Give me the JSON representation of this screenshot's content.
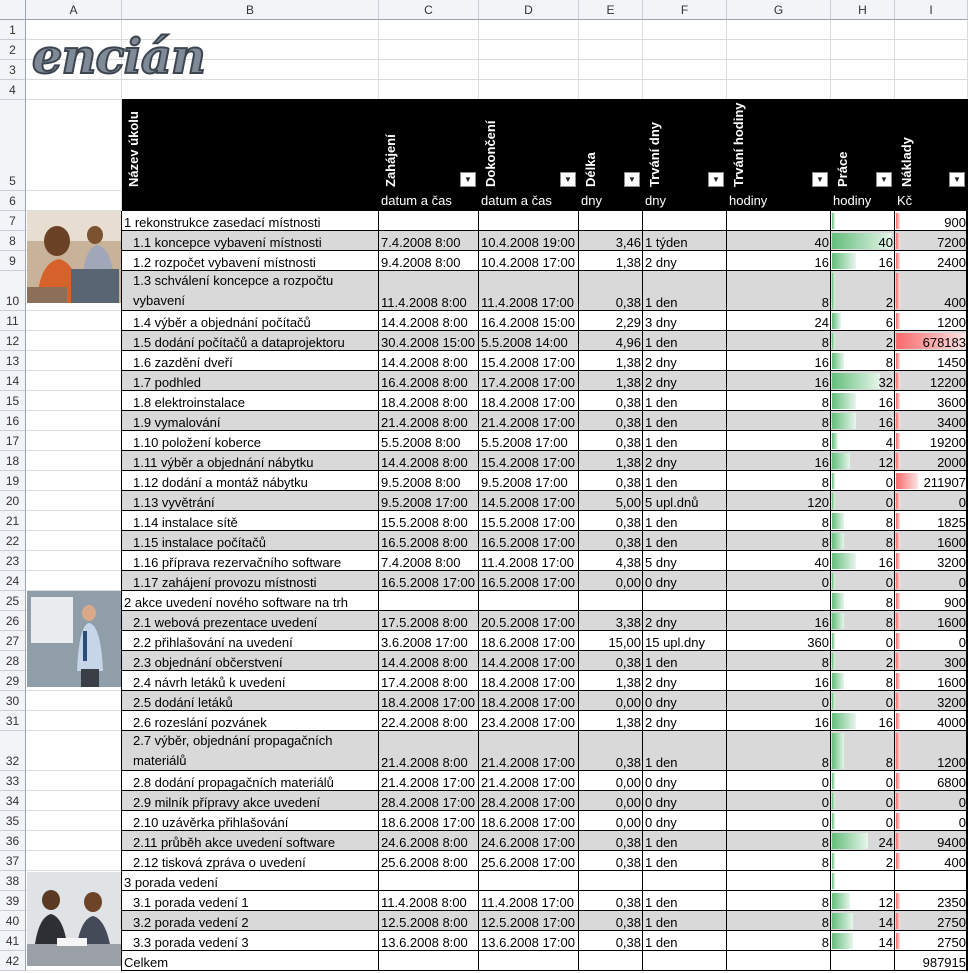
{
  "logo": {
    "text": "encián"
  },
  "columns": [
    "A",
    "B",
    "C",
    "D",
    "E",
    "F",
    "G",
    "H",
    "I"
  ],
  "rows": [
    "1",
    "2",
    "3",
    "4",
    "5",
    "6",
    "7",
    "8",
    "9",
    "10",
    "11",
    "12",
    "13",
    "14",
    "15",
    "16",
    "17",
    "18",
    "19",
    "20",
    "21",
    "22",
    "23",
    "24",
    "25",
    "26",
    "27",
    "28",
    "29",
    "30",
    "31",
    "32",
    "33",
    "34",
    "35",
    "36",
    "37",
    "38",
    "39",
    "40",
    "41",
    "42"
  ],
  "headers": [
    "Název úkolu",
    "Zahájení",
    "Dokončení",
    "Délka",
    "Trvání dny",
    "Trvání hodiny",
    "Práce",
    "Náklady"
  ],
  "units": [
    "datum a čas",
    "datum a čas",
    "dny",
    "dny",
    "hodiny",
    "hodiny",
    "Kč"
  ],
  "dropdown_icon": "filter-dropdown-icon",
  "colors": {
    "header_bg": "#000000",
    "row_alt": "#d9d9d9",
    "work_bar": "#63be7b",
    "cost_bar": "#f8696b"
  },
  "tasks": [
    {
      "r": 7,
      "name": "1 rekonstrukce zasedací místnosti",
      "summary": true,
      "start": "",
      "end": "",
      "len": "",
      "dur": "",
      "hrs": "",
      "work": "",
      "cost": "900",
      "w": 0,
      "c": 0.001
    },
    {
      "r": 8,
      "name": "1.1 koncepce vybavení místnosti",
      "start": "7.4.2008 8:00",
      "end": "10.4.2008 19:00",
      "len": "3,46",
      "dur": "1 týden",
      "hrs": "40",
      "work": "40",
      "cost": "7200",
      "w": 40,
      "c": 7200
    },
    {
      "r": 9,
      "name": "1.2 rozpočet vybavení místnosti",
      "start": "9.4.2008 8:00",
      "end": "10.4.2008 17:00",
      "len": "1,38",
      "dur": "2 dny",
      "hrs": "16",
      "work": "16",
      "cost": "2400",
      "w": 16,
      "c": 2400
    },
    {
      "r": 10,
      "name": "1.3 schválení koncepce a rozpočtu vybavení",
      "start": "11.4.2008 8:00",
      "end": "11.4.2008 17:00",
      "len": "0,38",
      "dur": "1 den",
      "hrs": "8",
      "work": "2",
      "cost": "400",
      "w": 2,
      "c": 400
    },
    {
      "r": 11,
      "name": "1.4 výběr a objednání počítačů",
      "start": "14.4.2008 8:00",
      "end": "16.4.2008 15:00",
      "len": "2,29",
      "dur": "3 dny",
      "hrs": "24",
      "work": "6",
      "cost": "1200",
      "w": 6,
      "c": 1200
    },
    {
      "r": 12,
      "name": "1.5 dodání počítačů a dataprojektoru",
      "start": "30.4.2008 15:00",
      "end": "5.5.2008 14:00",
      "len": "4,96",
      "dur": "1 den",
      "hrs": "8",
      "work": "2",
      "cost": "678183",
      "w": 2,
      "c": 678183
    },
    {
      "r": 13,
      "name": "1.6 zazdění dveří",
      "start": "14.4.2008 8:00",
      "end": "15.4.2008 17:00",
      "len": "1,38",
      "dur": "2 dny",
      "hrs": "16",
      "work": "8",
      "cost": "1450",
      "w": 8,
      "c": 1450
    },
    {
      "r": 14,
      "name": "1.7 podhled",
      "start": "16.4.2008 8:00",
      "end": "17.4.2008 17:00",
      "len": "1,38",
      "dur": "2 dny",
      "hrs": "16",
      "work": "32",
      "cost": "12200",
      "w": 32,
      "c": 12200
    },
    {
      "r": 15,
      "name": "1.8 elektroinstalace",
      "start": "18.4.2008 8:00",
      "end": "18.4.2008 17:00",
      "len": "0,38",
      "dur": "1 den",
      "hrs": "8",
      "work": "16",
      "cost": "3600",
      "w": 16,
      "c": 3600
    },
    {
      "r": 16,
      "name": "1.9 vymalování",
      "start": "21.4.2008 8:00",
      "end": "21.4.2008 17:00",
      "len": "0,38",
      "dur": "1 den",
      "hrs": "8",
      "work": "16",
      "cost": "3400",
      "w": 16,
      "c": 3400
    },
    {
      "r": 17,
      "name": "1.10 položení koberce",
      "start": "5.5.2008 8:00",
      "end": "5.5.2008 17:00",
      "len": "0,38",
      "dur": "1 den",
      "hrs": "8",
      "work": "4",
      "cost": "19200",
      "w": 4,
      "c": 19200
    },
    {
      "r": 18,
      "name": "1.11 výběr a objednání nábytku",
      "start": "14.4.2008 8:00",
      "end": "15.4.2008 17:00",
      "len": "1,38",
      "dur": "2 dny",
      "hrs": "16",
      "work": "12",
      "cost": "2000",
      "w": 12,
      "c": 2000
    },
    {
      "r": 19,
      "name": "1.12 dodání a montáž nábytku",
      "start": "9.5.2008 8:00",
      "end": "9.5.2008 17:00",
      "len": "0,38",
      "dur": "1 den",
      "hrs": "8",
      "work": "0",
      "cost": "211907",
      "w": 0,
      "c": 211907
    },
    {
      "r": 20,
      "name": "1.13 vyvětrání",
      "start": "9.5.2008 17:00",
      "end": "14.5.2008 17:00",
      "len": "5,00",
      "dur": "5 upl.dnů",
      "hrs": "120",
      "work": "0",
      "cost": "0",
      "w": 0,
      "c": 0
    },
    {
      "r": 21,
      "name": "1.14 instalace sítě",
      "start": "15.5.2008 8:00",
      "end": "15.5.2008 17:00",
      "len": "0,38",
      "dur": "1 den",
      "hrs": "8",
      "work": "8",
      "cost": "1825",
      "w": 8,
      "c": 1825
    },
    {
      "r": 22,
      "name": "1.15 instalace počítačů",
      "start": "16.5.2008 8:00",
      "end": "16.5.2008 17:00",
      "len": "0,38",
      "dur": "1 den",
      "hrs": "8",
      "work": "8",
      "cost": "1600",
      "w": 8,
      "c": 1600
    },
    {
      "r": 23,
      "name": "1.16 příprava rezervačního software",
      "start": "7.4.2008 8:00",
      "end": "11.4.2008 17:00",
      "len": "4,38",
      "dur": "5 dny",
      "hrs": "40",
      "work": "16",
      "cost": "3200",
      "w": 16,
      "c": 3200
    },
    {
      "r": 24,
      "name": "1.17 zahájení provozu místnosti",
      "start": "16.5.2008 17:00",
      "end": "16.5.2008 17:00",
      "len": "0,00",
      "dur": "0 dny",
      "hrs": "0",
      "work": "0",
      "cost": "0",
      "w": 0,
      "c": 0
    },
    {
      "r": 25,
      "name": "2 akce uvedení nového software na trh",
      "summary": true,
      "start": "",
      "end": "",
      "len": "",
      "dur": "",
      "hrs": "",
      "work": "8",
      "cost": "900",
      "w": 8,
      "c": 900
    },
    {
      "r": 26,
      "name": "2.1 webová prezentace uvedení",
      "start": "17.5.2008 8:00",
      "end": "20.5.2008 17:00",
      "len": "3,38",
      "dur": "2 dny",
      "hrs": "16",
      "work": "8",
      "cost": "1600",
      "w": 8,
      "c": 1600
    },
    {
      "r": 27,
      "name": "2.2 přihlašování na uvedení",
      "start": "3.6.2008 17:00",
      "end": "18.6.2008 17:00",
      "len": "15,00",
      "dur": "15 upl.dny",
      "hrs": "360",
      "work": "0",
      "cost": "0",
      "w": 0,
      "c": 0
    },
    {
      "r": 28,
      "name": "2.3 objednání občerstvení",
      "start": "14.4.2008 8:00",
      "end": "14.4.2008 17:00",
      "len": "0,38",
      "dur": "1 den",
      "hrs": "8",
      "work": "2",
      "cost": "300",
      "w": 2,
      "c": 300
    },
    {
      "r": 29,
      "name": "2.4 návrh letáků k uvedení",
      "start": "17.4.2008 8:00",
      "end": "18.4.2008 17:00",
      "len": "1,38",
      "dur": "2 dny",
      "hrs": "16",
      "work": "8",
      "cost": "1600",
      "w": 8,
      "c": 1600
    },
    {
      "r": 30,
      "name": "2.5 dodání letáků",
      "start": "18.4.2008 17:00",
      "end": "18.4.2008 17:00",
      "len": "0,00",
      "dur": "0 dny",
      "hrs": "0",
      "work": "0",
      "cost": "3200",
      "w": 0,
      "c": 3200
    },
    {
      "r": 31,
      "name": "2.6 rozeslání pozvánek",
      "start": "22.4.2008 8:00",
      "end": "23.4.2008 17:00",
      "len": "1,38",
      "dur": "2 dny",
      "hrs": "16",
      "work": "16",
      "cost": "4000",
      "w": 16,
      "c": 4000
    },
    {
      "r": 32,
      "name": "2.7 výběr, objednání propagačních materiálů",
      "start": "21.4.2008 8:00",
      "end": "21.4.2008 17:00",
      "len": "0,38",
      "dur": "1 den",
      "hrs": "8",
      "work": "8",
      "cost": "1200",
      "w": 8,
      "c": 1200
    },
    {
      "r": 33,
      "name": "2.8 dodání propagačních materiálů",
      "start": "21.4.2008 17:00",
      "end": "21.4.2008 17:00",
      "len": "0,00",
      "dur": "0 dny",
      "hrs": "0",
      "work": "0",
      "cost": "6800",
      "w": 0,
      "c": 6800
    },
    {
      "r": 34,
      "name": "2.9 milník přípravy akce uvedení",
      "start": "28.4.2008 17:00",
      "end": "28.4.2008 17:00",
      "len": "0,00",
      "dur": "0 dny",
      "hrs": "0",
      "work": "0",
      "cost": "0",
      "w": 0,
      "c": 0
    },
    {
      "r": 35,
      "name": "2.10 uzávěrka přihlašování",
      "start": "18.6.2008 17:00",
      "end": "18.6.2008 17:00",
      "len": "0,00",
      "dur": "0 dny",
      "hrs": "0",
      "work": "0",
      "cost": "0",
      "w": 0,
      "c": 0
    },
    {
      "r": 36,
      "name": "2.11 průběh akce uvedení software",
      "start": "24.6.2008 8:00",
      "end": "24.6.2008 17:00",
      "len": "0,38",
      "dur": "1 den",
      "hrs": "8",
      "work": "24",
      "cost": "9400",
      "w": 24,
      "c": 9400
    },
    {
      "r": 37,
      "name": "2.12 tisková zpráva o uvedení",
      "start": "25.6.2008 8:00",
      "end": "25.6.2008 17:00",
      "len": "0,38",
      "dur": "1 den",
      "hrs": "8",
      "work": "2",
      "cost": "400",
      "w": 2,
      "c": 400
    },
    {
      "r": 38,
      "name": "3 porada vedení",
      "summary": true,
      "start": "",
      "end": "",
      "len": "",
      "dur": "",
      "hrs": "",
      "work": "",
      "cost": "",
      "w": 0,
      "c": 0
    },
    {
      "r": 39,
      "name": "3.1 porada vedení 1",
      "start": "11.4.2008 8:00",
      "end": "11.4.2008 17:00",
      "len": "0,38",
      "dur": "1 den",
      "hrs": "8",
      "work": "12",
      "cost": "2350",
      "w": 12,
      "c": 2350
    },
    {
      "r": 40,
      "name": "3.2 porada vedení 2",
      "start": "12.5.2008 8:00",
      "end": "12.5.2008 17:00",
      "len": "0,38",
      "dur": "1 den",
      "hrs": "8",
      "work": "14",
      "cost": "2750",
      "w": 14,
      "c": 2750
    },
    {
      "r": 41,
      "name": "3.3 porada vedení 3",
      "start": "13.6.2008 8:00",
      "end": "13.6.2008 17:00",
      "len": "0,38",
      "dur": "1 den",
      "hrs": "8",
      "work": "14",
      "cost": "2750",
      "w": 14,
      "c": 2750
    },
    {
      "r": 42,
      "name": "Celkem",
      "total": true,
      "start": "",
      "end": "",
      "len": "",
      "dur": "",
      "hrs": "",
      "work": "",
      "cost": "987915",
      "w": 0,
      "c": 0
    }
  ]
}
